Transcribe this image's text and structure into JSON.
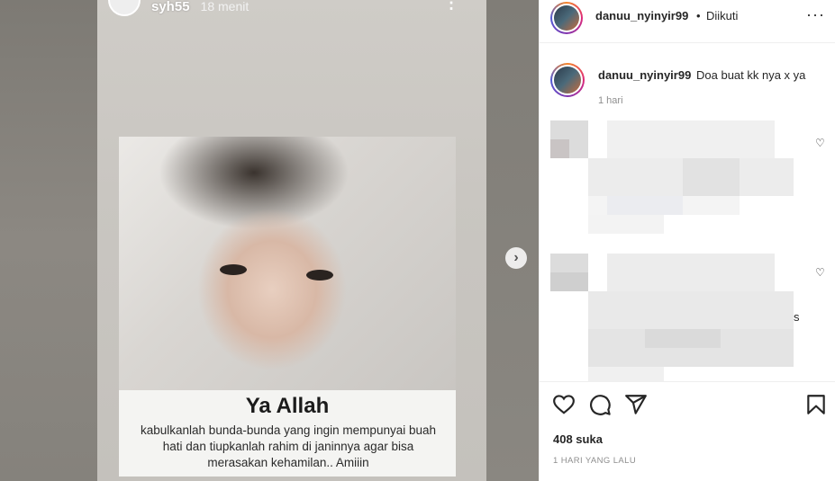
{
  "story": {
    "username": "syh55",
    "time": "18 menit",
    "card_title": "Ya Allah",
    "card_text": "kabulkanlah bunda-bunda yang ingin mempunyai buah hati dan tiupkanlah rahim di janinnya agar bisa merasakan kehamilan.. Amiiin"
  },
  "header": {
    "username": "danuu_nyinyir99",
    "separator": "•",
    "follow_status": "Diikuti",
    "more_icon": "more-horizontal-icon"
  },
  "caption": {
    "username": "danuu_nyinyir99",
    "text": "Doa buat kk nya x ya",
    "time": "1 hari"
  },
  "comments": [
    {
      "trailing": ""
    },
    {
      "trailing": "s"
    }
  ],
  "actions": {
    "like_icon": "heart-icon",
    "comment_icon": "comment-icon",
    "share_icon": "send-icon",
    "save_icon": "bookmark-icon"
  },
  "likes": "408 suka",
  "post_date": "1 HARI YANG LALU",
  "colors": {
    "text": "#262626",
    "muted": "#8e8e8e",
    "border": "#efefef"
  }
}
